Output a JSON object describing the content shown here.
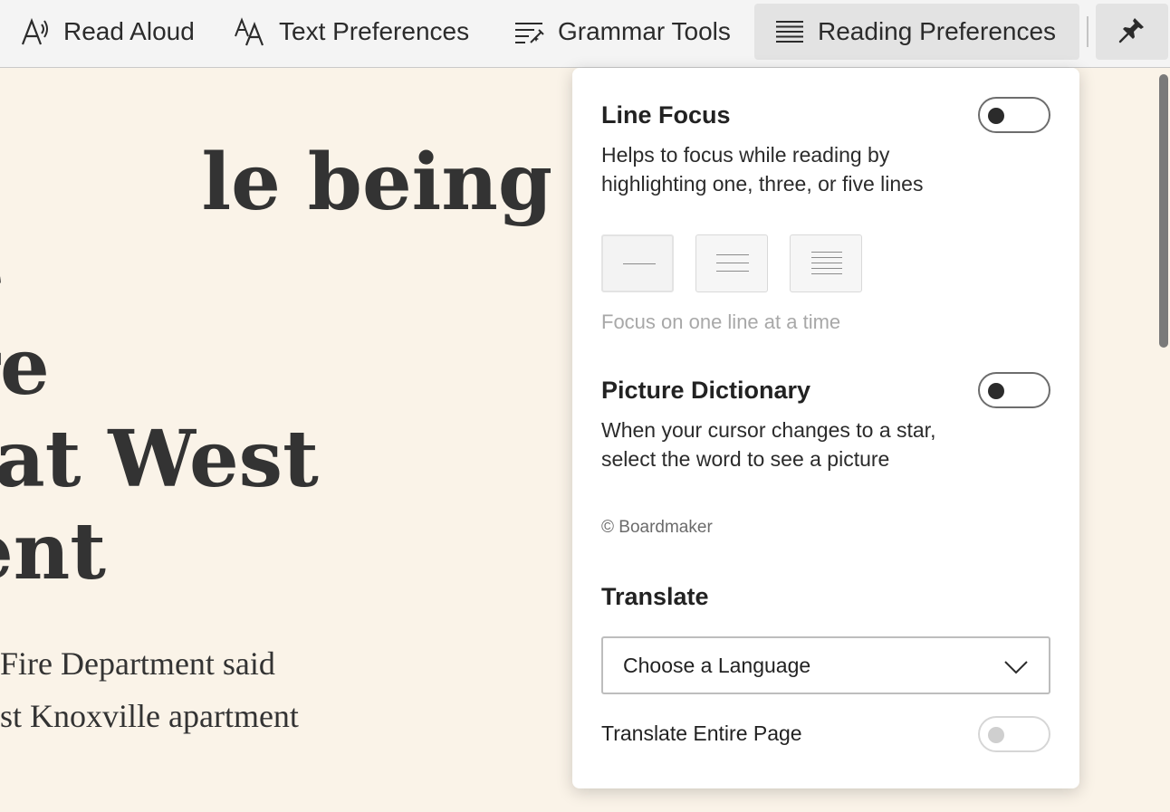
{
  "toolbar": {
    "read_aloud": "Read Aloud",
    "text_preferences": "Text Preferences",
    "grammar_tools": "Grammar Tools",
    "reading_preferences": "Reading Preferences"
  },
  "article": {
    "headline_lines": [
      "le being",
      "e",
      "ire",
      "at West",
      "ent"
    ],
    "body_lines": [
      "Fire Department said",
      "st Knoxville apartment"
    ]
  },
  "panel": {
    "line_focus": {
      "title": "Line Focus",
      "description": "Helps to focus while reading by highlighting one, three, or five lines",
      "enabled": false,
      "options": [
        "one-line",
        "three-lines",
        "five-lines"
      ],
      "selected": "one-line",
      "caption": "Focus on one line at a time"
    },
    "picture_dictionary": {
      "title": "Picture Dictionary",
      "description": "When your cursor changes to a star, select the word to see a picture",
      "enabled": false,
      "credit": "© Boardmaker"
    },
    "translate": {
      "title": "Translate",
      "select_value": "Choose a Language",
      "entire_page_label": "Translate Entire Page",
      "entire_page_enabled": false
    }
  },
  "colors": {
    "page_background": "#faf3e8",
    "toolbar_background": "#f4f4f4",
    "active_tab": "#e3e3e3",
    "panel_background": "#ffffff"
  },
  "icons": {
    "read_aloud": "read-aloud-icon",
    "text_preferences": "text-size-icon",
    "grammar_tools": "grammar-tools-icon",
    "reading_preferences": "reading-lines-icon",
    "pin": "pin-icon",
    "dropdown": "chevron-down-icon"
  }
}
